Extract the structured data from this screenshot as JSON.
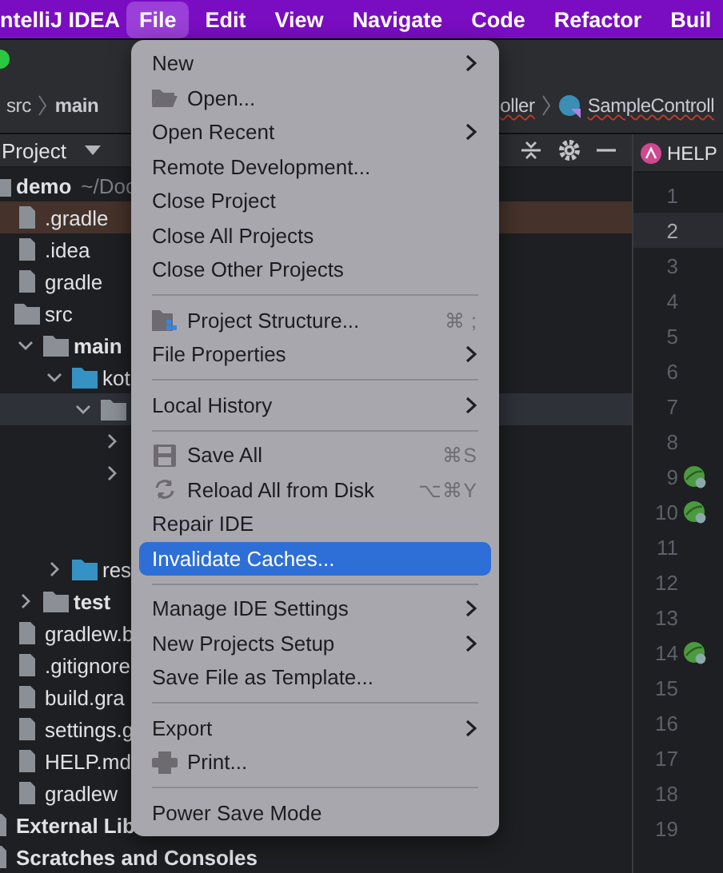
{
  "menubar": {
    "app": "ntelliJ IDEA",
    "menus": [
      {
        "label": "File",
        "selected": true
      },
      {
        "label": "Edit",
        "selected": false
      },
      {
        "label": "View",
        "selected": false
      },
      {
        "label": "Navigate",
        "selected": false
      },
      {
        "label": "Code",
        "selected": false
      },
      {
        "label": "Refactor",
        "selected": false
      },
      {
        "label": "Buil",
        "selected": false
      }
    ]
  },
  "breadcrumb": [
    "src",
    "main",
    "oller",
    "SampleControll"
  ],
  "project_panel": {
    "title": "Project",
    "tree": [
      {
        "label": "demo",
        "path": "~/Doc",
        "expanded": true,
        "selected": false,
        "children": [
          {
            "label": ".gradle",
            "excluded": true,
            "selected": false
          },
          {
            "label": ".idea",
            "selected": false
          },
          {
            "label": "gradle",
            "selected": false
          },
          {
            "label": "src",
            "expanded": true,
            "selected": false,
            "children": [
              {
                "label": "main",
                "expanded": true,
                "selected": false,
                "children": [
                  {
                    "label": "kot",
                    "expanded": true,
                    "selected": false,
                    "children": [
                      {
                        "expanded": true,
                        "selected": true,
                        "children": [
                          {
                            "expanded": false,
                            "selected": false
                          },
                          {
                            "expanded": false,
                            "selected": false
                          },
                          {
                            "selected": false
                          },
                          {
                            "selected": false
                          }
                        ]
                      }
                    ]
                  },
                  {
                    "label": "res",
                    "expanded": false,
                    "selected": false
                  }
                ]
              },
              {
                "label": "test",
                "expanded": false,
                "selected": false
              }
            ]
          },
          {
            "label": "gradlew.b",
            "selected": false
          },
          {
            "label": ".gitignore",
            "selected": false
          },
          {
            "label": "build.gra",
            "selected": false
          },
          {
            "label": "settings.g",
            "selected": false
          },
          {
            "label": "HELP.md",
            "selected": false
          },
          {
            "label": "gradlew",
            "selected": false
          }
        ]
      },
      {
        "label": "External Lib",
        "selected": false
      },
      {
        "label": "Scratches and Consoles",
        "selected": false
      }
    ]
  },
  "editor": {
    "tab": "HELP",
    "lines": [
      {
        "number": "1",
        "selected": false,
        "marker": false
      },
      {
        "number": "2",
        "selected": true,
        "marker": false
      },
      {
        "number": "3",
        "selected": false,
        "marker": false
      },
      {
        "number": "4",
        "selected": false,
        "marker": false
      },
      {
        "number": "5",
        "selected": false,
        "marker": false
      },
      {
        "number": "6",
        "selected": false,
        "marker": false
      },
      {
        "number": "7",
        "selected": false,
        "marker": false
      },
      {
        "number": "8",
        "selected": false,
        "marker": false
      },
      {
        "number": "9",
        "selected": false,
        "marker": true
      },
      {
        "number": "10",
        "selected": false,
        "marker": true
      },
      {
        "number": "11",
        "selected": false,
        "marker": false
      },
      {
        "number": "12",
        "selected": false,
        "marker": false
      },
      {
        "number": "13",
        "selected": false,
        "marker": false
      },
      {
        "number": "14",
        "selected": false,
        "marker": true
      },
      {
        "number": "15",
        "selected": false,
        "marker": false
      },
      {
        "number": "16",
        "selected": false,
        "marker": false
      },
      {
        "number": "17",
        "selected": false,
        "marker": false
      },
      {
        "number": "18",
        "selected": false,
        "marker": false
      },
      {
        "number": "19",
        "selected": false,
        "marker": false
      }
    ]
  },
  "file_menu": [
    {
      "kind": "item",
      "label": "New",
      "submenu": true,
      "selected": false
    },
    {
      "kind": "item",
      "label": "Open...",
      "selected": false
    },
    {
      "kind": "item",
      "label": "Open Recent",
      "submenu": true,
      "selected": false
    },
    {
      "kind": "item",
      "label": "Remote Development...",
      "selected": false
    },
    {
      "kind": "item",
      "label": "Close Project",
      "selected": false
    },
    {
      "kind": "item",
      "label": "Close All Projects",
      "selected": false
    },
    {
      "kind": "item",
      "label": "Close Other Projects",
      "selected": false
    },
    {
      "kind": "separator"
    },
    {
      "kind": "item",
      "label": "Project Structure...",
      "shortcut": "⌘ ;",
      "selected": false
    },
    {
      "kind": "item",
      "label": "File Properties",
      "submenu": true,
      "selected": false
    },
    {
      "kind": "separator"
    },
    {
      "kind": "item",
      "label": "Local History",
      "submenu": true,
      "selected": false
    },
    {
      "kind": "separator"
    },
    {
      "kind": "item",
      "label": "Save All",
      "shortcut": "⌘S",
      "selected": false
    },
    {
      "kind": "item",
      "label": "Reload All from Disk",
      "shortcut": "⌥⌘Y",
      "selected": false
    },
    {
      "kind": "item",
      "label": "Repair IDE",
      "selected": false
    },
    {
      "kind": "item",
      "label": "Invalidate Caches...",
      "selected": true
    },
    {
      "kind": "separator"
    },
    {
      "kind": "item",
      "label": "Manage IDE Settings",
      "submenu": true,
      "selected": false
    },
    {
      "kind": "item",
      "label": "New Projects Setup",
      "submenu": true,
      "selected": false
    },
    {
      "kind": "item",
      "label": "Save File as Template...",
      "selected": false
    },
    {
      "kind": "separator"
    },
    {
      "kind": "item",
      "label": "Export",
      "submenu": true,
      "selected": false
    },
    {
      "kind": "item",
      "label": "Print...",
      "selected": false
    },
    {
      "kind": "separator"
    },
    {
      "kind": "item",
      "label": "Power Save Mode",
      "selected": false
    }
  ]
}
